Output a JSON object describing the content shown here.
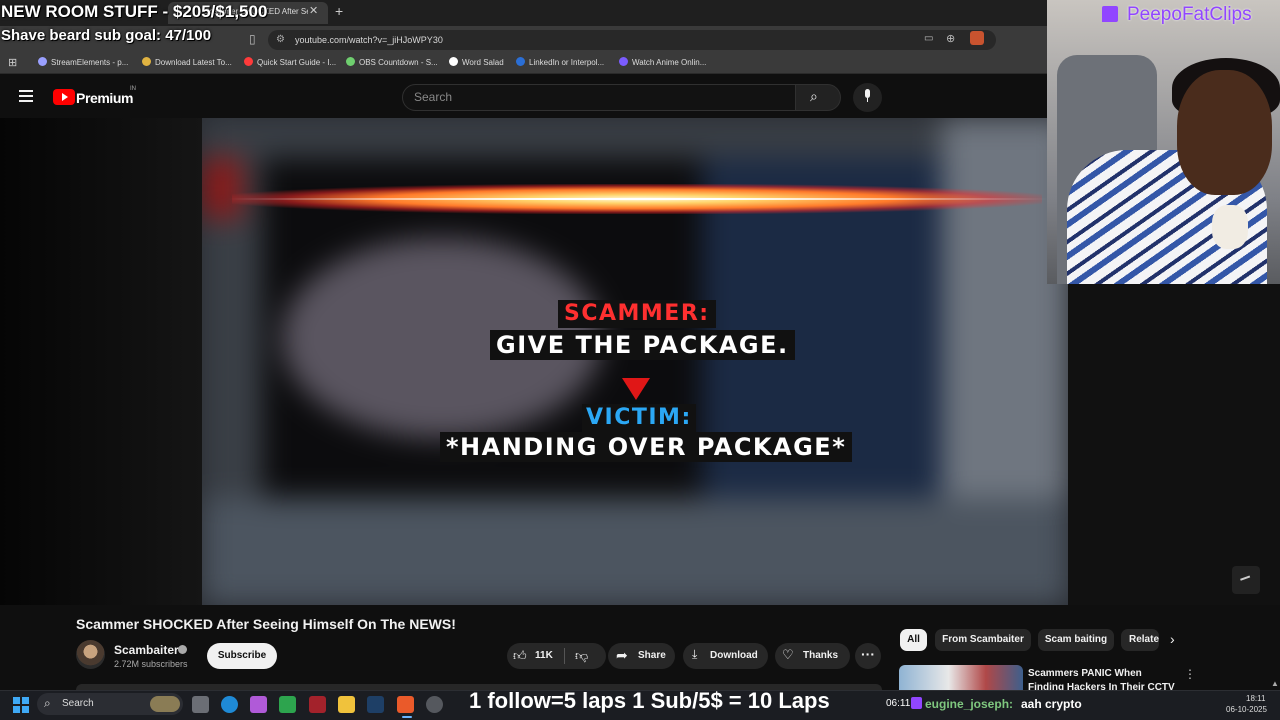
{
  "overlay": {
    "goal_line_1": "NEW ROOM STUFF - $205/$1,500",
    "goal_line_2": "Shave beard sub goal: 47/100",
    "webcam_brand": "PeepoFatClips",
    "ticker": "1 follow=5 laps 1 Sub/5$ = 10 Laps",
    "chat_time": "06:11",
    "chat_user": "eugine_joseph:",
    "chat_message": "aah crypto"
  },
  "browser": {
    "active_tab_title": "Scammer SHOCKED After Seeing Himself On The NEWS!",
    "address_url": "youtube.com/watch?v=_jiHJoWPY30",
    "bookmarks": [
      {
        "label": "StreamElements - p...",
        "color": "#9aa0ff"
      },
      {
        "label": "Download Latest To...",
        "color": "#e0b341"
      },
      {
        "label": "Quick Start Guide - I...",
        "color": "#ff3b3b"
      },
      {
        "label": "OBS Countdown - S...",
        "color": "#6fcf6f"
      },
      {
        "label": "Word Salad",
        "color": "#ffffff"
      },
      {
        "label": "LinkedIn or Interpol...",
        "color": "#2b6fd6"
      },
      {
        "label": "Watch Anime Onlin...",
        "color": "#7b5cff"
      }
    ]
  },
  "youtube": {
    "brand": "Premium",
    "region": "IN",
    "search_placeholder": "Search"
  },
  "video": {
    "caption_scammer": "SCAMMER:",
    "caption_give": "GIVE THE PACKAGE.",
    "caption_victim": "VICTIM:",
    "caption_handing": "*HANDING OVER PACKAGE*",
    "title": "Scammer SHOCKED After Seeing Himself On The NEWS!"
  },
  "channel": {
    "name": "Scambaiter",
    "subscribers": "2.72M subscribers",
    "subscribe_label": "Subscribe"
  },
  "actions": {
    "like_count": "11K",
    "share_label": "Share",
    "download_label": "Download",
    "thanks_label": "Thanks"
  },
  "chips": {
    "all": "All",
    "from": "From Scambaiter",
    "scam": "Scam baiting",
    "related": "Related"
  },
  "recommendation": {
    "title": "Scammers PANIC When Finding Hackers In Their CCTV"
  },
  "taskbar": {
    "search_label": "Search",
    "time": "18:11",
    "date": "06-10-2025"
  }
}
